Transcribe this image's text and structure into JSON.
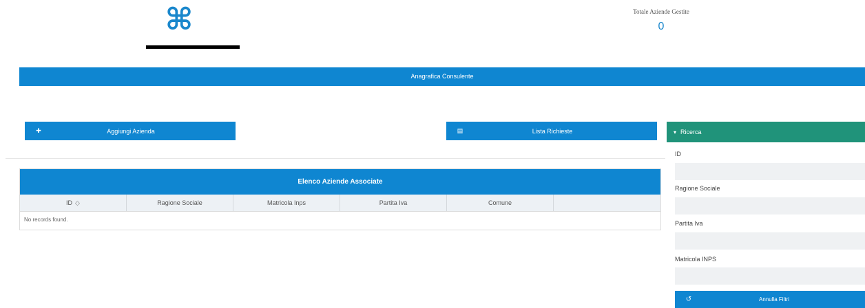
{
  "header": {
    "logo_icon": "command-icon",
    "logo_glyph": "⌘",
    "totale_label": "Totale Aziende Gestite",
    "totale_value": "0"
  },
  "band": {
    "label": "Anagrafica Consulente"
  },
  "actions": {
    "aggiungi": {
      "label": "Aggiungi Azienda",
      "icon": "plus-circle-icon",
      "glyph": "✚"
    },
    "lista": {
      "label": "Lista Richieste",
      "icon": "list-icon",
      "glyph": "▤"
    }
  },
  "table": {
    "title": "Elenco Aziende Associate",
    "columns": [
      "ID",
      "Ragione Sociale",
      "Matricola Inps",
      "Partita Iva",
      "Comune",
      ""
    ],
    "sort_glyph": "◇",
    "empty_text": "No records found."
  },
  "ricerca": {
    "title": "Ricerca",
    "chevron": "▾",
    "fields": [
      {
        "label": "ID",
        "value": ""
      },
      {
        "label": "Ragione Sociale",
        "value": ""
      },
      {
        "label": "Partita Iva",
        "value": ""
      },
      {
        "label": "Matricola INPS",
        "value": ""
      }
    ],
    "annulla": {
      "label": "Annulla Filtri",
      "icon": "undo-icon",
      "glyph": "↺"
    }
  },
  "colors": {
    "primary": "#0f86d1",
    "accent_green": "#20937a",
    "header_bg": "#edf1f5"
  }
}
